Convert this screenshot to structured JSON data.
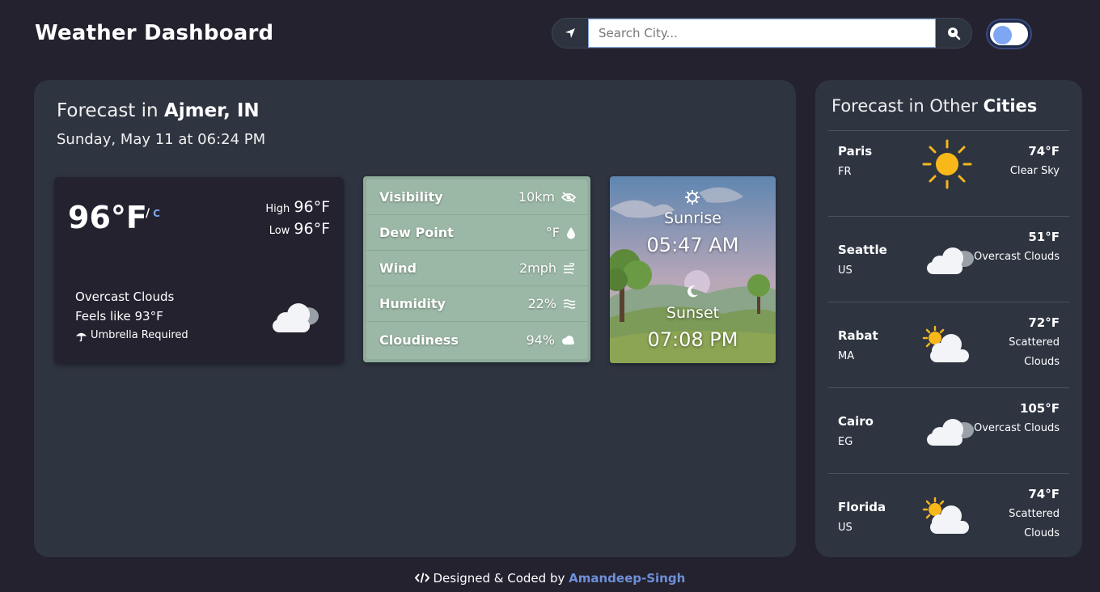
{
  "header": {
    "title": "Weather Dashboard",
    "search_placeholder": "Search City...",
    "location_icon": "location-arrow-icon",
    "search_icon": "search-location-icon"
  },
  "current": {
    "title_prefix": "Forecast in",
    "location": "Ajmer, IN",
    "datetime": "Sunday, May 11 at 06:24 PM",
    "temperature": "96°F",
    "unit_sep": "/",
    "unit_alt": "C",
    "high_label": "High",
    "high_value": "96°F",
    "low_label": "Low",
    "low_value": "96°F",
    "condition": "Overcast Clouds",
    "feels_like": "Feels like 93°F",
    "advice": "Umbrella Required",
    "icon": "overcast-clouds-icon"
  },
  "details": [
    {
      "label": "Visibility",
      "value": "10km",
      "icon": "eye-slash-icon"
    },
    {
      "label": "Dew Point",
      "value": "°F",
      "icon": "droplet-icon"
    },
    {
      "label": "Wind",
      "value": "2mph",
      "icon": "wind-icon"
    },
    {
      "label": "Humidity",
      "value": "22%",
      "icon": "water-icon"
    },
    {
      "label": "Cloudiness",
      "value": "94%",
      "icon": "cloud-icon"
    }
  ],
  "sun": {
    "sunrise_label": "Sunrise",
    "sunrise_time": "05:47 AM",
    "sunset_label": "Sunset",
    "sunset_time": "07:08 PM"
  },
  "other": {
    "title_prefix": "Forecast in Other",
    "title_bold": "Cities",
    "cities": [
      {
        "name": "Paris",
        "country": "FR",
        "temp": "74°F",
        "desc": "Clear Sky",
        "icon": "sun-icon"
      },
      {
        "name": "Seattle",
        "country": "US",
        "temp": "51°F",
        "desc": "Overcast Clouds",
        "icon": "overcast-clouds-icon"
      },
      {
        "name": "Rabat",
        "country": "MA",
        "temp": "72°F",
        "desc": "Scattered Clouds",
        "icon": "partly-cloudy-icon"
      },
      {
        "name": "Cairo",
        "country": "EG",
        "temp": "105°F",
        "desc": "Overcast Clouds",
        "icon": "overcast-clouds-icon"
      },
      {
        "name": "Florida",
        "country": "US",
        "temp": "74°F",
        "desc": "Scattered Clouds",
        "icon": "partly-cloudy-icon"
      }
    ]
  },
  "footer": {
    "text": "Designed & Coded by",
    "author": "Amandeep-Singh",
    "icon": "code-icon"
  },
  "colors": {
    "background": "#24222f",
    "panel": "#2e3440",
    "accent": "#6f8fd8",
    "details_card": "#9bb7a5"
  }
}
